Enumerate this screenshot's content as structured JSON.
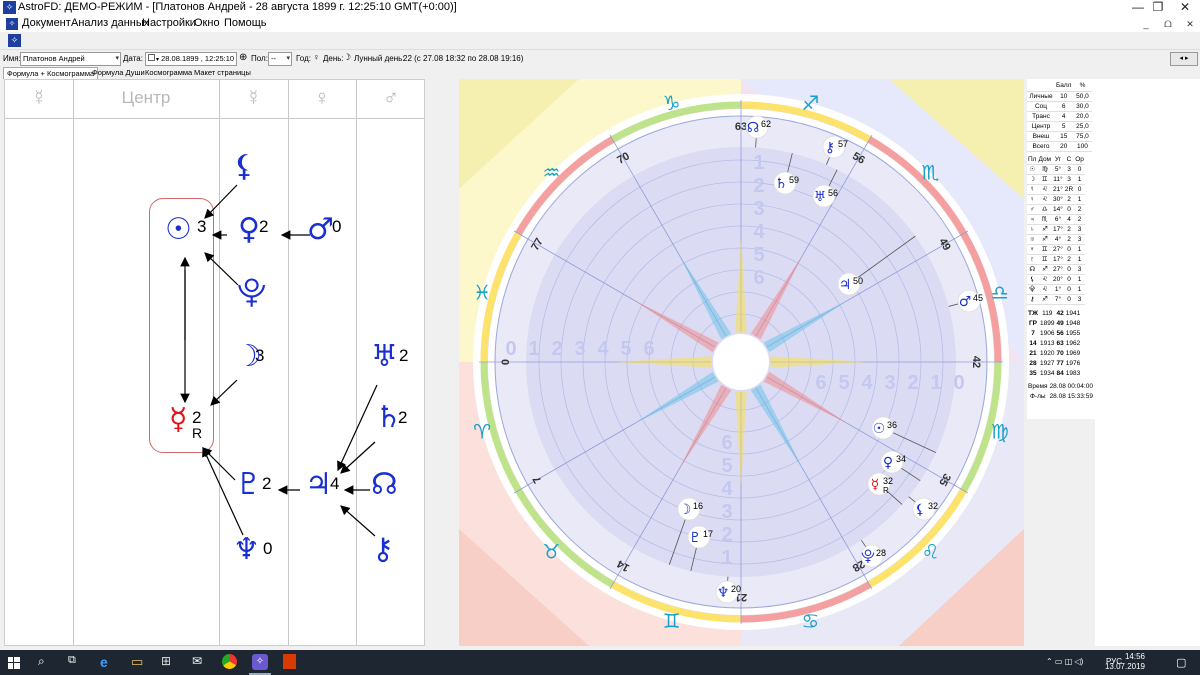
{
  "window": {
    "title": "AstroFD: ДЕМО-РЕЖИМ - [Платонов Андрей - 28 августа 1899 г. 12:25:10 GMT(+0:00)]",
    "min_label": "—",
    "max_label": "❐",
    "close_label": "✕"
  },
  "menu": {
    "items": [
      "Документ",
      "Анализ данных",
      "Настройки",
      "Окно",
      "Помощь"
    ],
    "mdi_min": "_",
    "mdi_restore": "ᗝ",
    "mdi_close": "✕"
  },
  "inputbar": {
    "name_label": "Имя:",
    "name_value": "Платонов Андрей",
    "date_label": "Дата:",
    "date_value": "28.08.1899 , 12:25:10",
    "pol_label": "Пол:",
    "pol_value": "--",
    "year_label": "Год:",
    "year_glyph": "♀",
    "day_label": "День:",
    "day_glyph": "☽",
    "lunar_label": "Лунный день:",
    "lunar_value": "22 (с 27.08 18:32 по 28.08 19:16)",
    "nav": "◂ ▸"
  },
  "tabs": [
    "Формула + Космограмма",
    "Формула Души",
    "Космограмма",
    "Макет страницы"
  ],
  "formula": {
    "headers": [
      "☿",
      "Центр",
      "☿",
      "♀",
      "♂"
    ],
    "planets": [
      {
        "name": "moon-lilith",
        "glyph": "⚸",
        "num": "",
        "color": "#1a2fd1"
      },
      {
        "name": "sun",
        "glyph": "☉",
        "num": "3",
        "color": "#1a2fd1"
      },
      {
        "name": "venus",
        "glyph": "♀",
        "num": "2",
        "color": "#1a2fd1"
      },
      {
        "name": "mars",
        "glyph": "♂",
        "num": "0",
        "color": "#1a2fd1"
      },
      {
        "name": "proserpina",
        "glyph": "⯓",
        "num": "",
        "color": "#1a2fd1"
      },
      {
        "name": "moon",
        "glyph": "☽",
        "num": "3",
        "color": "#1a2fd1"
      },
      {
        "name": "uranus",
        "glyph": "♅",
        "num": "2",
        "color": "#1a2fd1"
      },
      {
        "name": "mercury",
        "glyph": "☿",
        "num": "2",
        "num2": "R",
        "color": "#e0131a"
      },
      {
        "name": "saturn",
        "glyph": "♄",
        "num": "2",
        "color": "#1a2fd1"
      },
      {
        "name": "pluto",
        "glyph": "♇",
        "num": "2",
        "color": "#1a2fd1"
      },
      {
        "name": "jupiter",
        "glyph": "♃",
        "num": "4",
        "color": "#1a2fd1"
      },
      {
        "name": "node",
        "glyph": "☊",
        "num": "",
        "color": "#1a2fd1"
      },
      {
        "name": "neptune",
        "glyph": "♆",
        "num": "0",
        "color": "#1a2fd1"
      },
      {
        "name": "chiron",
        "glyph": "⚷",
        "num": "",
        "color": "#1a2fd1"
      }
    ]
  },
  "cosmogram": {
    "degree_labels": [
      "63",
      "56",
      "49",
      "42",
      "35",
      "28",
      "21",
      "14",
      "7",
      "0",
      "77",
      "70"
    ],
    "signs": [
      "♐",
      "♏",
      "♎",
      "♍",
      "♌",
      "♋",
      "♊",
      "♉",
      "♈",
      "♓",
      "♒",
      "♑"
    ],
    "ring_numbers_top": [
      "1",
      "2",
      "3",
      "4",
      "5",
      "6"
    ],
    "ring_numbers_left": [
      "0",
      "1",
      "2",
      "3",
      "4",
      "5",
      "6"
    ],
    "ring_numbers_right": [
      "6",
      "5",
      "4",
      "3",
      "2",
      "1",
      "0"
    ],
    "ring_numbers_bottom": [
      "6",
      "5",
      "4",
      "3",
      "2",
      "1"
    ],
    "planet_markers": [
      {
        "name": "node",
        "glyph": "☊",
        "deg": "62",
        "color": "#1a2fd1"
      },
      {
        "name": "chiron",
        "glyph": "⚷",
        "deg": "57",
        "color": "#1a2fd1"
      },
      {
        "name": "saturn",
        "glyph": "♄",
        "deg": "59",
        "color": "#1a2fd1"
      },
      {
        "name": "uranus",
        "glyph": "♅",
        "deg": "56",
        "color": "#1a2fd1"
      },
      {
        "name": "jupiter",
        "glyph": "♃",
        "deg": "50",
        "color": "#1a2fd1"
      },
      {
        "name": "mars",
        "glyph": "♂",
        "deg": "45",
        "color": "#1a2fd1"
      },
      {
        "name": "sun",
        "glyph": "☉",
        "deg": "36",
        "color": "#1a2fd1"
      },
      {
        "name": "venus",
        "glyph": "♀",
        "deg": "34",
        "color": "#1a2fd1"
      },
      {
        "name": "mercury",
        "glyph": "☿",
        "deg": "32",
        "deg2": "R",
        "color": "#e0131a"
      },
      {
        "name": "lilith",
        "glyph": "⚸",
        "deg": "32",
        "color": "#1a2fd1"
      },
      {
        "name": "proserpina",
        "glyph": "⯓",
        "deg": "28",
        "color": "#1a2fd1"
      },
      {
        "name": "neptune",
        "glyph": "♆",
        "deg": "20",
        "color": "#1a2fd1"
      },
      {
        "name": "pluto",
        "glyph": "♇",
        "deg": "17",
        "color": "#1a2fd1"
      },
      {
        "name": "moon",
        "glyph": "☽",
        "deg": "16",
        "color": "#1a2fd1"
      }
    ]
  },
  "score_table": {
    "header": [
      "",
      "Балл",
      "%"
    ],
    "rows": [
      [
        "Личные",
        "10",
        "50,0"
      ],
      [
        "Соц",
        "6",
        "30,0"
      ],
      [
        "Транс",
        "4",
        "20,0"
      ],
      [
        "Центр",
        "5",
        "25,0"
      ],
      [
        "Внеш",
        "15",
        "75,0"
      ],
      [
        "Всего",
        "20",
        "100"
      ]
    ]
  },
  "planet_table": {
    "header": [
      "Пл",
      "Дом",
      "Уг",
      "С",
      "Ор"
    ],
    "rows": [
      [
        "☉",
        "♍",
        "5°",
        "3",
        "0"
      ],
      [
        "☽",
        "♊",
        "11°",
        "3",
        "1"
      ],
      [
        "☿",
        "♌",
        "21°",
        "2R",
        "0"
      ],
      [
        "♀",
        "♌",
        "30°",
        "2",
        "1"
      ],
      [
        "♂",
        "♎",
        "14°",
        "0",
        "2"
      ],
      [
        "♃",
        "♏",
        "6°",
        "4",
        "2"
      ],
      [
        "♄",
        "♐",
        "17°",
        "2",
        "3"
      ],
      [
        "♅",
        "♐",
        "4°",
        "2",
        "3"
      ],
      [
        "♆",
        "♊",
        "27°",
        "0",
        "1"
      ],
      [
        "♇",
        "♊",
        "17°",
        "2",
        "1"
      ],
      [
        "☊",
        "♐",
        "27°",
        "0",
        "3"
      ],
      [
        "⚸",
        "♌",
        "20°",
        "0",
        "1"
      ],
      [
        "⯓",
        "♌",
        "1°",
        "0",
        "1"
      ],
      [
        "⚷",
        "♐",
        "7°",
        "0",
        "3"
      ]
    ]
  },
  "year_table": {
    "rows": [
      [
        "ТЖ",
        "119",
        "42",
        "1941"
      ],
      [
        "ГР",
        "1899",
        "49",
        "1948"
      ],
      [
        "7",
        "1906",
        "56",
        "1955"
      ],
      [
        "14",
        "1913",
        "63",
        "1962"
      ],
      [
        "21",
        "1920",
        "70",
        "1969"
      ],
      [
        "28",
        "1927",
        "77",
        "1976"
      ],
      [
        "35",
        "1934",
        "84",
        "1983"
      ]
    ]
  },
  "time_table": {
    "rows": [
      [
        "Время",
        "28.08 00:04:00"
      ],
      [
        "Ф-лы",
        "28.08 15:33:59"
      ]
    ]
  },
  "tray": {
    "lang": "РУС",
    "time": "14:56",
    "date": "13.07.2019"
  },
  "colors": {
    "accent": "#1a2fd1",
    "retro": "#e0131a",
    "arrow": "#000000"
  }
}
